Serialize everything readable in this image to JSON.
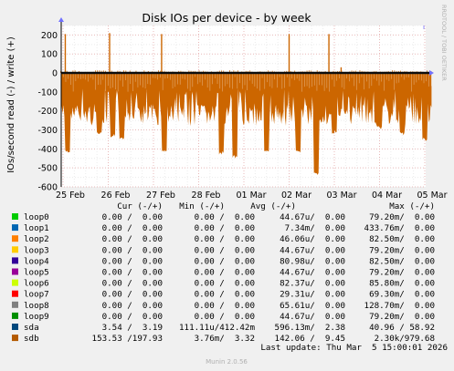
{
  "title": "Disk IOs per device - by week",
  "ylabel": "IOs/second read (-) / write (+)",
  "side_label": "RRDTOOL / TOBI OETIKER",
  "footer": "Munin 2.0.56",
  "last_update": "Last update: Thu Mar  5 15:00:01 2026",
  "colors": {
    "sdb": "#cc6600",
    "sda": "#005a7d",
    "background": "#f0f0f0",
    "plot_bg": "#ffffff",
    "grid_major": "#e8b8b8"
  },
  "legend": {
    "headers": [
      "Cur (-/+)",
      "Min (-/+)",
      "Avg (-/+)",
      "Max (-/+)"
    ],
    "rows": [
      {
        "name": "loop0",
        "color": "#00cc00",
        "cur": "0.00 /  0.00",
        "min": "0.00 /  0.00",
        "avg": "44.67u/  0.00",
        "max": "79.20m/  0.00"
      },
      {
        "name": "loop1",
        "color": "#0066b3",
        "cur": "0.00 /  0.00",
        "min": "0.00 /  0.00",
        "avg": "7.34m/  0.00",
        "max": "433.76m/  0.00"
      },
      {
        "name": "loop2",
        "color": "#ff8000",
        "cur": "0.00 /  0.00",
        "min": "0.00 /  0.00",
        "avg": "46.06u/  0.00",
        "max": "82.50m/  0.00"
      },
      {
        "name": "loop3",
        "color": "#ffcc00",
        "cur": "0.00 /  0.00",
        "min": "0.00 /  0.00",
        "avg": "44.67u/  0.00",
        "max": "79.20m/  0.00"
      },
      {
        "name": "loop4",
        "color": "#330099",
        "cur": "0.00 /  0.00",
        "min": "0.00 /  0.00",
        "avg": "80.98u/  0.00",
        "max": "82.50m/  0.00"
      },
      {
        "name": "loop5",
        "color": "#990099",
        "cur": "0.00 /  0.00",
        "min": "0.00 /  0.00",
        "avg": "44.67u/  0.00",
        "max": "79.20m/  0.00"
      },
      {
        "name": "loop6",
        "color": "#ccff00",
        "cur": "0.00 /  0.00",
        "min": "0.00 /  0.00",
        "avg": "82.37u/  0.00",
        "max": "85.80m/  0.00"
      },
      {
        "name": "loop7",
        "color": "#ff0000",
        "cur": "0.00 /  0.00",
        "min": "0.00 /  0.00",
        "avg": "29.31u/  0.00",
        "max": "69.30m/  0.00"
      },
      {
        "name": "loop8",
        "color": "#808080",
        "cur": "0.00 /  0.00",
        "min": "0.00 /  0.00",
        "avg": "65.61u/  0.00",
        "max": "128.70m/  0.00"
      },
      {
        "name": "loop9",
        "color": "#008f00",
        "cur": "0.00 /  0.00",
        "min": "0.00 /  0.00",
        "avg": "44.67u/  0.00",
        "max": "79.20m/  0.00"
      },
      {
        "name": "sda",
        "color": "#00487d",
        "cur": "3.54 /  3.19",
        "min": "111.11u/412.42m",
        "avg": "596.13m/  2.38",
        "max": "40.96 / 58.92"
      },
      {
        "name": "sdb",
        "color": "#b35a00",
        "cur": "153.53 /197.93",
        "min": "3.76m/  3.32",
        "avg": "142.06 /  9.45",
        "max": "2.30k/979.68"
      }
    ]
  },
  "chart_data": {
    "type": "area",
    "title": "Disk IOs per device - by week",
    "ylabel": "IOs/second read (-) / write (+)",
    "ylim": [
      -600,
      250
    ],
    "yticks": [
      200,
      100,
      0,
      -100,
      -200,
      -300,
      -400,
      -500,
      -600
    ],
    "xticks": [
      "25 Feb",
      "26 Feb",
      "27 Feb",
      "28 Feb",
      "01 Mar",
      "02 Mar",
      "03 Mar",
      "04 Mar",
      "05 Mar"
    ],
    "grid": true,
    "series": [
      {
        "name": "sdb",
        "write_points": [
          [
            0.05,
            205
          ],
          [
            1.03,
            210
          ],
          [
            2.18,
            205
          ],
          [
            5.0,
            205
          ],
          [
            5.88,
            205
          ],
          [
            6.15,
            30
          ]
        ],
        "read_typical": -160,
        "read_min_points": [
          [
            0.1,
            -420
          ],
          [
            0.8,
            -330
          ],
          [
            1.1,
            -340
          ],
          [
            1.3,
            -360
          ],
          [
            2.25,
            -420
          ],
          [
            3.5,
            -430
          ],
          [
            3.8,
            -450
          ],
          [
            4.5,
            -415
          ],
          [
            5.2,
            -420
          ],
          [
            5.6,
            -540
          ],
          [
            6.0,
            -320
          ],
          [
            7.0,
            -300
          ],
          [
            7.5,
            -330
          ],
          [
            8.0,
            -360
          ],
          [
            8.45,
            -280
          ]
        ]
      },
      {
        "name": "sda",
        "write_typical": 3,
        "read_typical": -3
      }
    ]
  }
}
